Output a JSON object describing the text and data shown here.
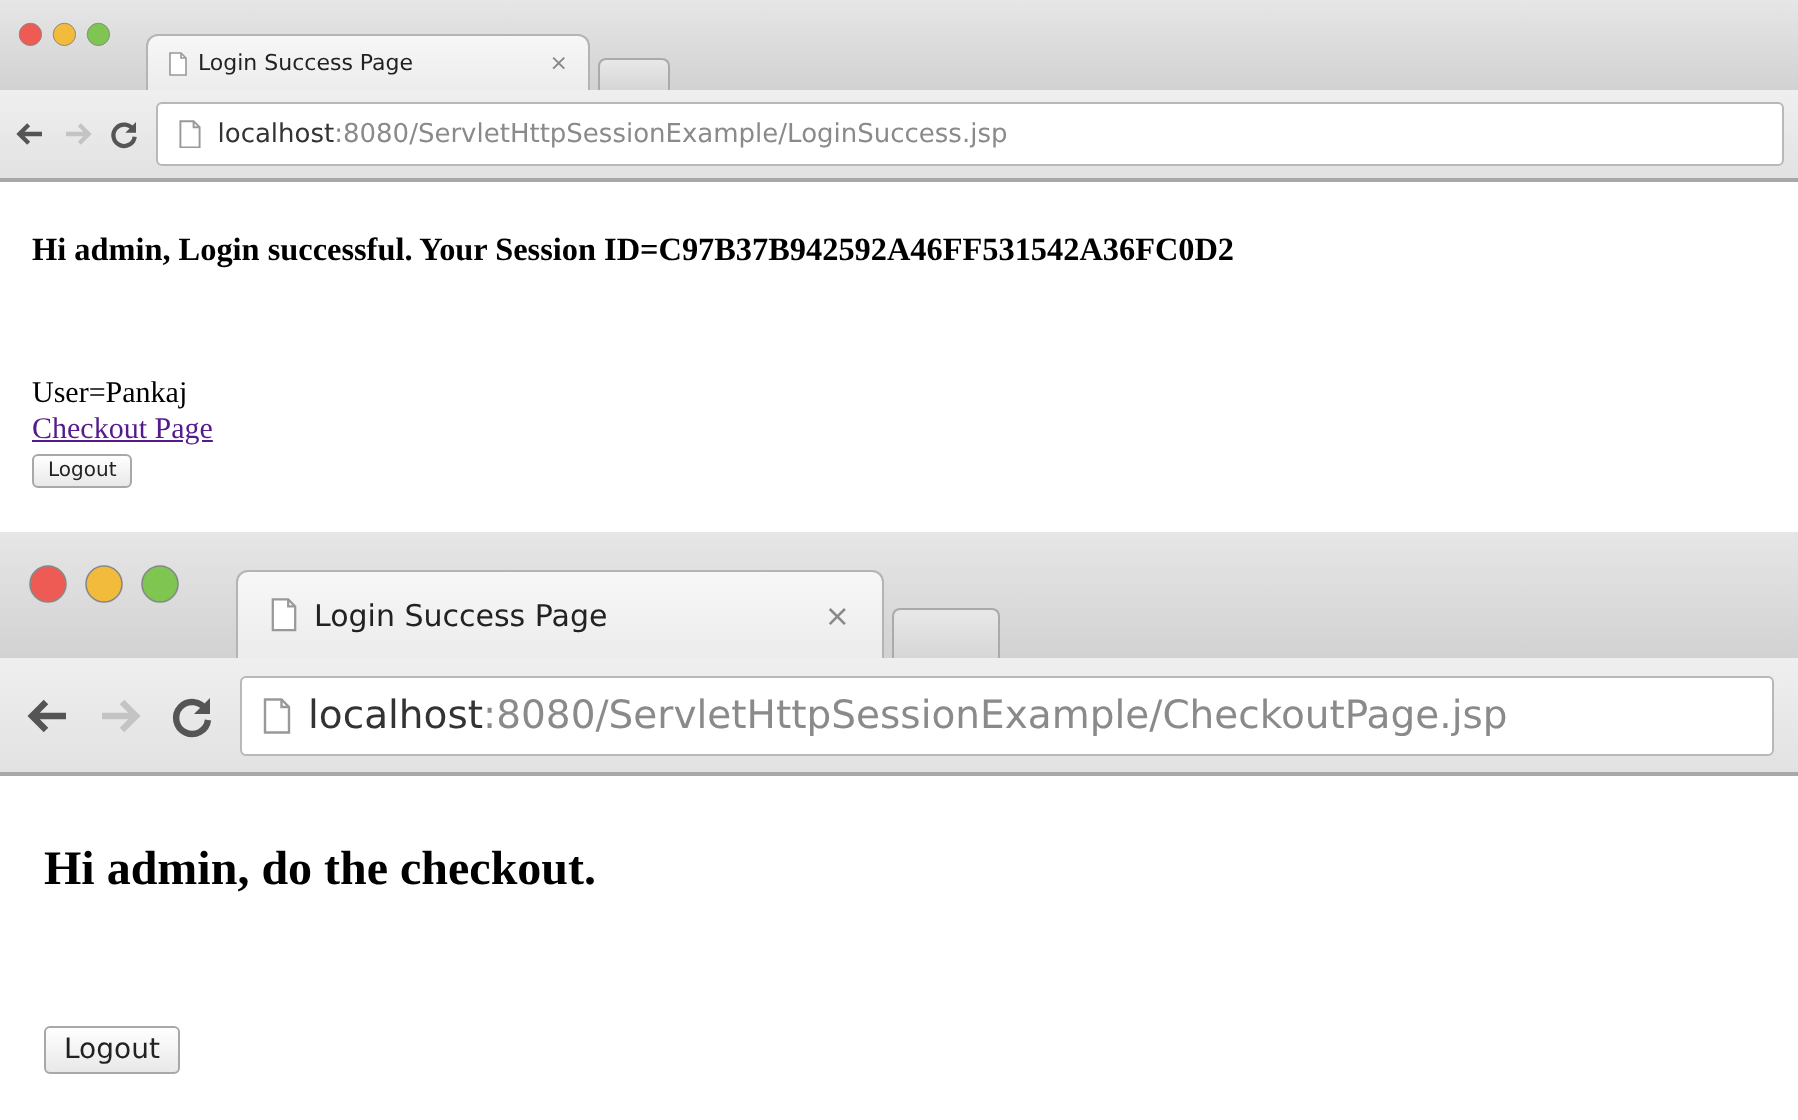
{
  "windows": [
    {
      "tab": {
        "title": "Login Success Page",
        "close": "×"
      },
      "nav": {
        "back_disabled": false,
        "forward_disabled": true
      },
      "address": "**localhost**:8080/ServletHttpSessionExample/LoginSuccess.jsp",
      "content": [
        {
          "kind": "heading",
          "text": "Hi admin, Login successful. Your Session ID=C97B37B942592A46FF531542A36FC0D2"
        },
        {
          "kind": "text",
          "text": "User=Pankaj"
        },
        {
          "kind": "link",
          "text": "Checkout Page"
        },
        {
          "kind": "button",
          "text": "Logout"
        }
      ]
    },
    {
      "tab": {
        "title": "Login Success Page",
        "close": "×"
      },
      "nav": {
        "back_disabled": false,
        "forward_disabled": true
      },
      "address": "**localhost**:8080/ServletHttpSessionExample/CheckoutPage.jsp",
      "content": [
        {
          "kind": "heading",
          "text": "Hi admin, do the checkout."
        },
        {
          "kind": "button",
          "text": "Logout"
        }
      ]
    }
  ]
}
